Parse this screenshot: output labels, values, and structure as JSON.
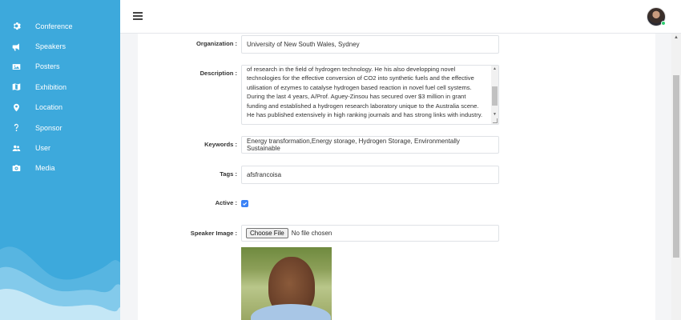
{
  "sidebar": {
    "items": [
      {
        "label": "Conference",
        "icon": "gear-icon"
      },
      {
        "label": "Speakers",
        "icon": "megaphone-icon"
      },
      {
        "label": "Posters",
        "icon": "image-icon"
      },
      {
        "label": "Exhibition",
        "icon": "book-open-icon"
      },
      {
        "label": "Location",
        "icon": "map-pin-icon"
      },
      {
        "label": "Sponsor",
        "icon": "question-icon"
      },
      {
        "label": "User",
        "icon": "users-icon"
      },
      {
        "label": "Media",
        "icon": "camera-icon"
      }
    ],
    "background_color": "#3da9dc"
  },
  "topbar": {
    "menu_icon": "hamburger-icon",
    "avatar_status_color": "#2ecc71"
  },
  "form": {
    "organization": {
      "label": "Organization :",
      "value": "University of New South Wales, Sydney"
    },
    "description": {
      "label": "Description :",
      "value": "of research in the field of hydrogen technology. He his also developping novel technologies for the effective conversion of CO2 into synthetic fuels and the effective utilisation of ezymes to catalyse hydrogen based reaction in novel fuel cell systems. During the last 4 years, A/Prof. Aguey-Zinsou has secured over $3 million in grant funding and established a hydrogen research laboratory unique to the Australia scene. He has published extensively in high ranking journals and has strong links with industry."
    },
    "keywords": {
      "label": "Keywords :",
      "value": "Energy transformation,Energy storage, Hydrogen Storage, Environmentally Sustainable"
    },
    "tags": {
      "label": "Tags :",
      "value": "afsfrancoisa"
    },
    "active": {
      "label": "Active :",
      "checked": true
    },
    "speaker_image": {
      "label": "Speaker Image :",
      "button_label": "Choose File",
      "status": "No file chosen"
    }
  },
  "colors": {
    "accent": "#3b82f6"
  }
}
